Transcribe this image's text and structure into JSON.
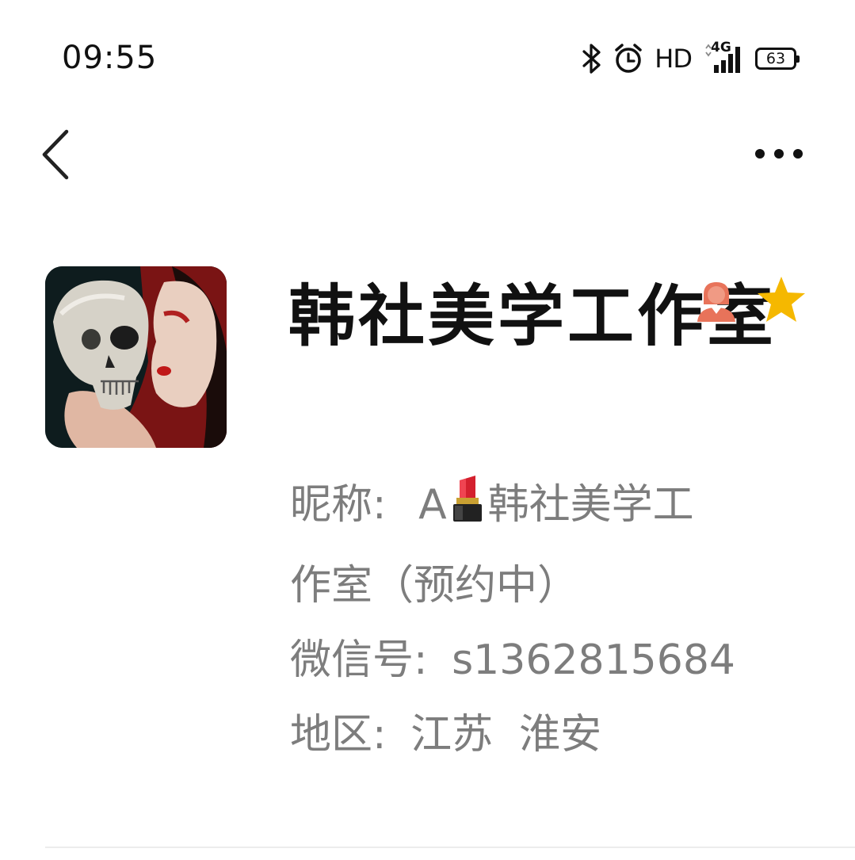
{
  "status_bar": {
    "time": "09:55",
    "hd_label": "HD",
    "network_label": "4G",
    "battery_level": "63",
    "icons": [
      "bluetooth-icon",
      "alarm-icon",
      "signal-icon",
      "battery-icon"
    ]
  },
  "nav": {
    "back_icon": "chevron-left-icon",
    "more_icon": "more-dots-icon"
  },
  "profile": {
    "display_name": "韩社美学工作室",
    "badges": [
      "female-user-icon",
      "star-icon"
    ],
    "nickname_label": "昵称:",
    "nickname_prefix": "A",
    "nickname_emoji": "lipstick-icon",
    "nickname_rest_line1": "韩社美学工",
    "nickname_rest_line2": "作室（预约中）",
    "wechat_label": "微信号:",
    "wechat_id": "s1362815684",
    "region_label": "地区:",
    "region_value": "江苏  淮安"
  },
  "colors": {
    "text_primary": "#111111",
    "text_secondary": "#7d7d7d",
    "badge_person": "#e8735a",
    "badge_star": "#f5b800",
    "divider": "#ececec"
  }
}
